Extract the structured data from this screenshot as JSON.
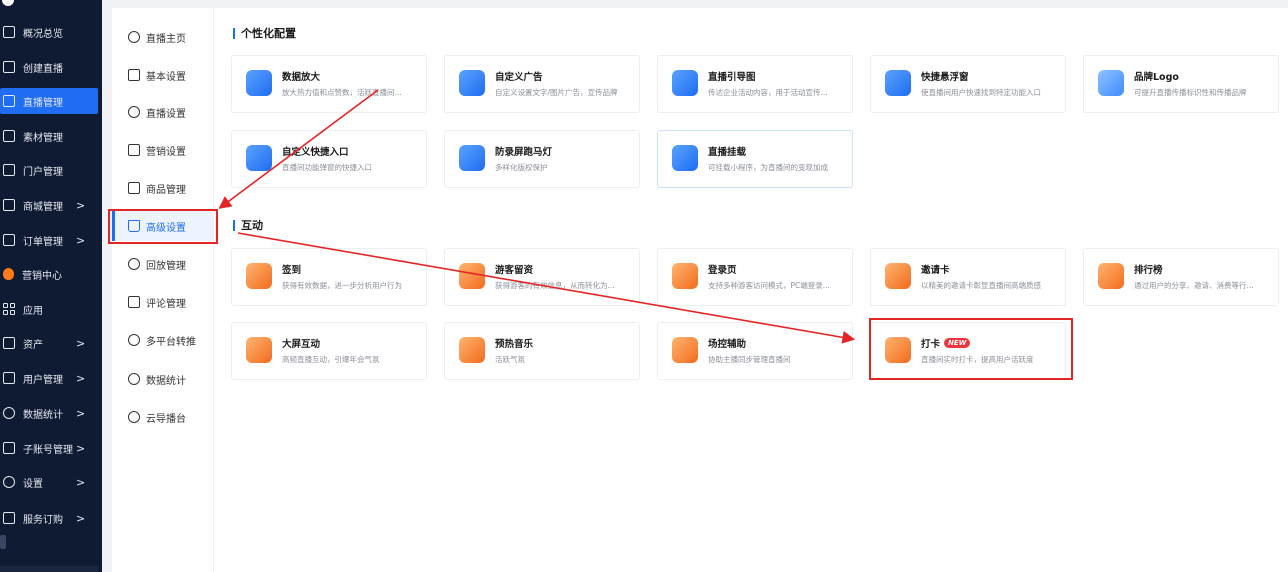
{
  "sidebar": {
    "items": [
      {
        "label": "概况总览",
        "icon": "monitor-icon",
        "chevron": ""
      },
      {
        "label": "创建直播",
        "icon": "add-live-icon",
        "chevron": ""
      },
      {
        "label": "直播管理",
        "icon": "live-icon",
        "chevron": ""
      },
      {
        "label": "素材管理",
        "icon": "folder-icon",
        "chevron": ""
      },
      {
        "label": "门户管理",
        "icon": "home-icon",
        "chevron": ""
      },
      {
        "label": "商城管理",
        "icon": "shop-icon",
        "chevron": ">"
      },
      {
        "label": "订单管理",
        "icon": "order-icon",
        "chevron": ">"
      },
      {
        "label": "营销中心",
        "icon": "fire-icon",
        "chevron": ""
      },
      {
        "label": "应用",
        "icon": "apps-grid-icon",
        "chevron": ""
      },
      {
        "label": "资产",
        "icon": "asset-icon",
        "chevron": ">"
      },
      {
        "label": "用户管理",
        "icon": "users-icon",
        "chevron": ">"
      },
      {
        "label": "数据统计",
        "icon": "pie-chart-icon",
        "chevron": ">"
      },
      {
        "label": "子账号管理",
        "icon": "sub-account-icon",
        "chevron": ">"
      },
      {
        "label": "设置",
        "icon": "gear-icon",
        "chevron": ">"
      },
      {
        "label": "服务订购",
        "icon": "service-icon",
        "chevron": ">"
      }
    ],
    "active_index": 2
  },
  "submenu": {
    "items": [
      {
        "label": "直播主页",
        "icon": "play-circle-icon"
      },
      {
        "label": "基本设置",
        "icon": "edit-icon"
      },
      {
        "label": "直播设置",
        "icon": "settings-circle-icon"
      },
      {
        "label": "营销设置",
        "icon": "gift-icon"
      },
      {
        "label": "商品管理",
        "icon": "bag-icon"
      },
      {
        "label": "高级设置",
        "icon": "crown-icon"
      },
      {
        "label": "回放管理",
        "icon": "replay-icon"
      },
      {
        "label": "评论管理",
        "icon": "comment-icon"
      },
      {
        "label": "多平台转推",
        "icon": "share-icon"
      },
      {
        "label": "数据统计",
        "icon": "stats-icon"
      },
      {
        "label": "云导播台",
        "icon": "cloud-icon"
      }
    ],
    "active_index": 5
  },
  "sections": [
    {
      "title": "个性化配置",
      "cards": [
        {
          "title": "数据放大",
          "desc": "放大热力值和点赞数，活跃直播间...",
          "icon": "chart-up-icon",
          "color": "blue",
          "badge": ""
        },
        {
          "title": "自定义广告",
          "desc": "自定义设置文字/图片广告，宣传品牌",
          "icon": "ad-icon",
          "color": "blue",
          "badge": ""
        },
        {
          "title": "直播引导图",
          "desc": "传达企业活动内容，用于活动宣传...",
          "icon": "image-icon",
          "color": "blue",
          "badge": ""
        },
        {
          "title": "快捷悬浮窗",
          "desc": "使直播间用户快速找到特定功能入口",
          "icon": "float-window-icon",
          "color": "blue",
          "badge": ""
        },
        {
          "title": "品牌Logo",
          "desc": "可提升直播传播标识性和传播品牌",
          "icon": "logo-icon",
          "color": "lblue",
          "badge": ""
        },
        {
          "title": "自定义快捷入口",
          "desc": "直播间功能弹窗的快捷入口",
          "icon": "shortcut-icon",
          "color": "blue",
          "badge": ""
        },
        {
          "title": "防录屏跑马灯",
          "desc": "多样化版权保护",
          "icon": "camera-icon",
          "color": "blue",
          "badge": ""
        },
        {
          "title": "直播挂载",
          "desc": "可挂载小程序，为直播间的变现加成",
          "icon": "rocket-icon",
          "color": "blue",
          "badge": ""
        }
      ]
    },
    {
      "title": "互动",
      "cards": [
        {
          "title": "签到",
          "desc": "获得有效数据，进一步分析用户行为",
          "icon": "calendar-check-icon",
          "color": "orange",
          "badge": ""
        },
        {
          "title": "游客留资",
          "desc": "获得游客的有效信息，从而转化为...",
          "icon": "form-icon",
          "color": "orange",
          "badge": ""
        },
        {
          "title": "登录页",
          "desc": "支持多种游客访问模式，PC端登录...",
          "icon": "login-icon",
          "color": "orange",
          "badge": ""
        },
        {
          "title": "邀请卡",
          "desc": "以精美的邀请卡彰显直播间高端质感",
          "icon": "invite-card-icon",
          "color": "orange",
          "badge": ""
        },
        {
          "title": "排行榜",
          "desc": "通过用户的分享、邀请、消费等行...",
          "icon": "trophy-icon",
          "color": "orange",
          "badge": ""
        },
        {
          "title": "大屏互动",
          "desc": "高频直播互动，引爆年会气氛",
          "icon": "screen-icon",
          "color": "orange",
          "badge": ""
        },
        {
          "title": "预热音乐",
          "desc": "活跃气氛",
          "icon": "music-icon",
          "color": "orange",
          "badge": ""
        },
        {
          "title": "场控辅助",
          "desc": "协助主播同步管理直播间",
          "icon": "control-icon",
          "color": "orange",
          "badge": ""
        },
        {
          "title": "打卡",
          "desc": "直播间实时打卡，提高用户活跃度",
          "icon": "checkin-icon",
          "color": "orange",
          "badge": "NEW"
        }
      ]
    }
  ],
  "colors": {
    "accent": "#1e6df2",
    "sidebar_bg": "#0f1b33",
    "annotation_red": "#e42525",
    "badge_red": "#f0343d"
  }
}
